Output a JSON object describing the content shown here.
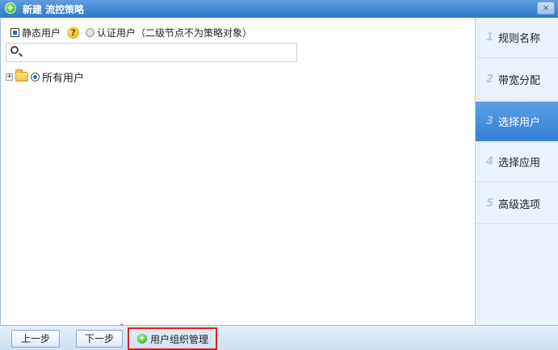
{
  "dialog": {
    "title": "新建 流控策略",
    "close_label": "×"
  },
  "user_type": {
    "static_label": "静态用户",
    "static_selected": true,
    "help_label": "?",
    "auth_label": "认证用户（二级节点不为策略对象）",
    "auth_selected": false
  },
  "search": {
    "value": "",
    "placeholder": ""
  },
  "tree": {
    "expander": "+",
    "root_label": "所有用户",
    "root_selected": true
  },
  "steps": [
    {
      "num": "1",
      "label": "规则名称",
      "active": false
    },
    {
      "num": "2",
      "label": "带宽分配",
      "active": false
    },
    {
      "num": "3",
      "label": "选择用户",
      "active": true
    },
    {
      "num": "4",
      "label": "选择应用",
      "active": false
    },
    {
      "num": "5",
      "label": "高级选项",
      "active": false
    }
  ],
  "footer": {
    "prev_label": "上一步",
    "next_label": "下一步",
    "manage_icon": "+",
    "manage_label": "用户组织管理"
  }
}
